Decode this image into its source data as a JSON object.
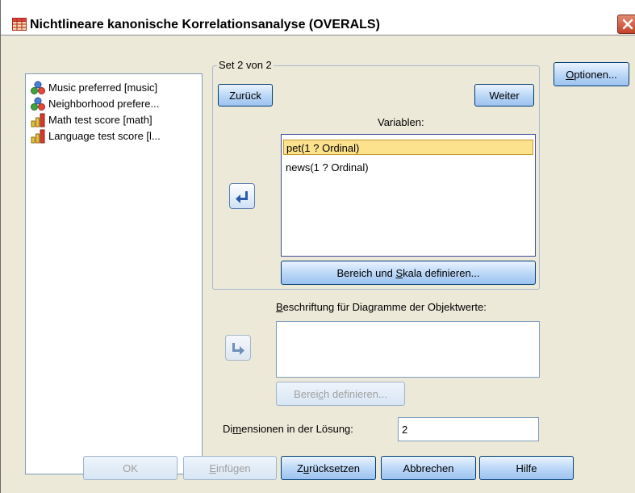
{
  "window": {
    "title": "Nichtlineare kanonische Korrelationsanalyse (OVERALS)"
  },
  "source_list": [
    {
      "label": "Music preferred [music]",
      "icon": "nominal-icon"
    },
    {
      "label": "Neighborhood prefere...",
      "icon": "nominal-icon"
    },
    {
      "label": "Math test score [math]",
      "icon": "scale-icon"
    },
    {
      "label": "Language test score [l...",
      "icon": "scale-icon"
    }
  ],
  "set_group": {
    "legend": "Set 2  von 2",
    "back_label": "Zurück",
    "next_label": "Weiter",
    "variables_label": "Variablen:",
    "variables": [
      "pet(1 ? Ordinal)",
      "news(1 ? Ordinal)"
    ],
    "define_range_scale_label": "Bereich und Skala definieren..."
  },
  "options_label": "Optionen...",
  "object_scores": {
    "label": "Beschriftung für Diagramme der Objektwerte:",
    "define_range_label": "Bereich definieren..."
  },
  "dimensions": {
    "label": "Dimensionen in der Lösung:",
    "value": "2"
  },
  "footer": {
    "ok": "OK",
    "paste": "Einfügen",
    "reset": "Zurücksetzen",
    "cancel": "Abbrechen",
    "help": "Hilfe"
  },
  "colors": {
    "selection": "#fde28d",
    "accent_border": "#003c74",
    "close": "#c4422a"
  }
}
